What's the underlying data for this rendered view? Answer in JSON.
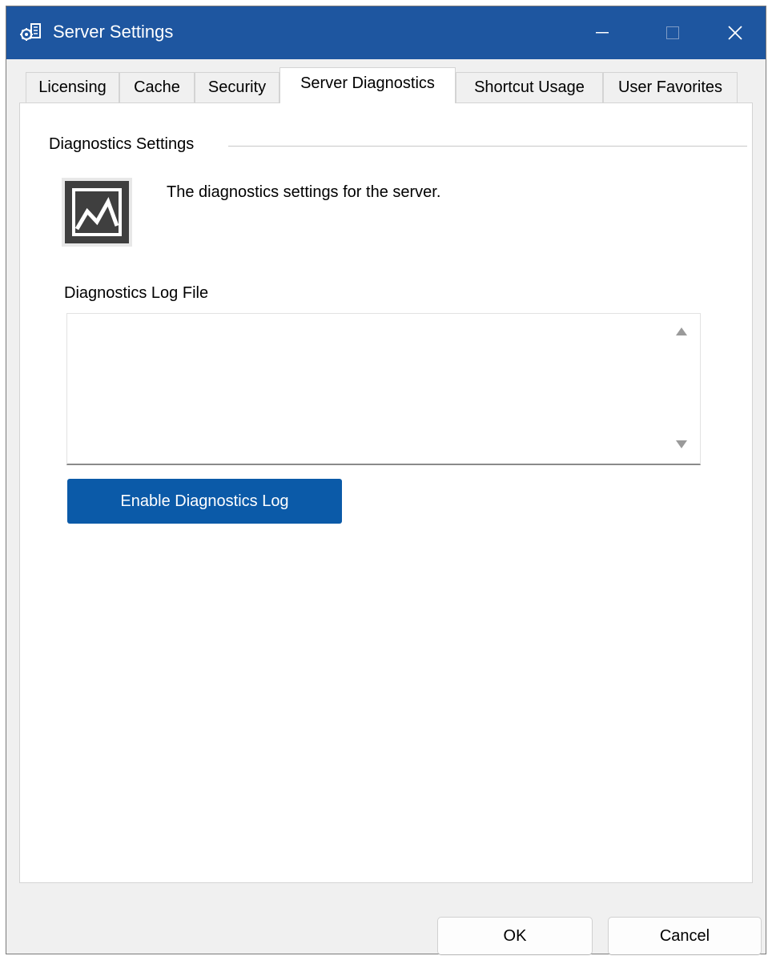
{
  "window": {
    "title": "Server Settings",
    "title_color": "#ffffff",
    "titlebar_color": "#1e56a0",
    "controls": [
      "minimize-icon",
      "maximize-icon",
      "close-icon"
    ]
  },
  "tabs": [
    {
      "label": "Licensing",
      "selected": false
    },
    {
      "label": "Cache",
      "selected": false
    },
    {
      "label": "Security",
      "selected": false
    },
    {
      "label": "Server Diagnostics",
      "selected": true
    },
    {
      "label": "Shortcut Usage",
      "selected": false
    },
    {
      "label": "User Favorites",
      "selected": false
    }
  ],
  "panel": {
    "group_header": "Diagnostics Settings",
    "icon": "diagnostics-chart-icon",
    "description": "The diagnostics settings for the server.",
    "log_file_label": "Diagnostics Log File",
    "log_file_value": "",
    "enable_button_label": "Enable Diagnostics Log",
    "accent_color": "#0b5aa8"
  },
  "footer": {
    "ok_label": "OK",
    "cancel_label": "Cancel"
  }
}
